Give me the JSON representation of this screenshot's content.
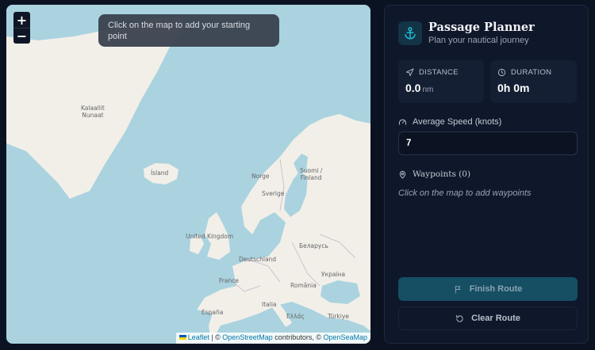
{
  "map": {
    "zoom_in": "+",
    "zoom_out": "−",
    "hint": "Click on the map to add your starting point",
    "labels": {
      "greenland": "Kalaallit\nNunaat",
      "iceland": "Ísland",
      "norway": "Norge",
      "sweden": "Sverige",
      "finland": "Suomi /\nFinland",
      "uk": "United Kingdom",
      "germany": "Deutschland",
      "belarus": "Беларусь",
      "france": "France",
      "ukraine": "Україна",
      "romania": "România",
      "italy": "Italia",
      "spain": "España",
      "greece": "Ελλάς",
      "turkey": "Türkiye"
    },
    "attribution": {
      "leaflet": "Leaflet",
      "sep": " | © ",
      "osm": "OpenStreetMap",
      "mid": " contributors, © ",
      "osea": "OpenSeaMap"
    }
  },
  "panel": {
    "icon": "anchor-icon",
    "title": "Passage Planner",
    "subtitle": "Plan your nautical journey",
    "distance": {
      "label": "DISTANCE",
      "value": "0.0",
      "unit": "nm",
      "icon": "navigation-arrow-icon"
    },
    "duration": {
      "label": "DURATION",
      "value": "0h 0m",
      "icon": "clock-icon"
    },
    "speed": {
      "label": "Average Speed (knots)",
      "value": "7",
      "icon": "gauge-icon"
    },
    "waypoints": {
      "label": "Waypoints (0)",
      "hint": "Click on the map to add waypoints",
      "icon": "map-pin-icon"
    },
    "finish_button": "Finish Route",
    "clear_button": "Clear Route"
  },
  "colors": {
    "accent": "#164e63",
    "panel_bg": "#0f172a",
    "sea": "#aad3df",
    "land": "#f2efe9"
  }
}
